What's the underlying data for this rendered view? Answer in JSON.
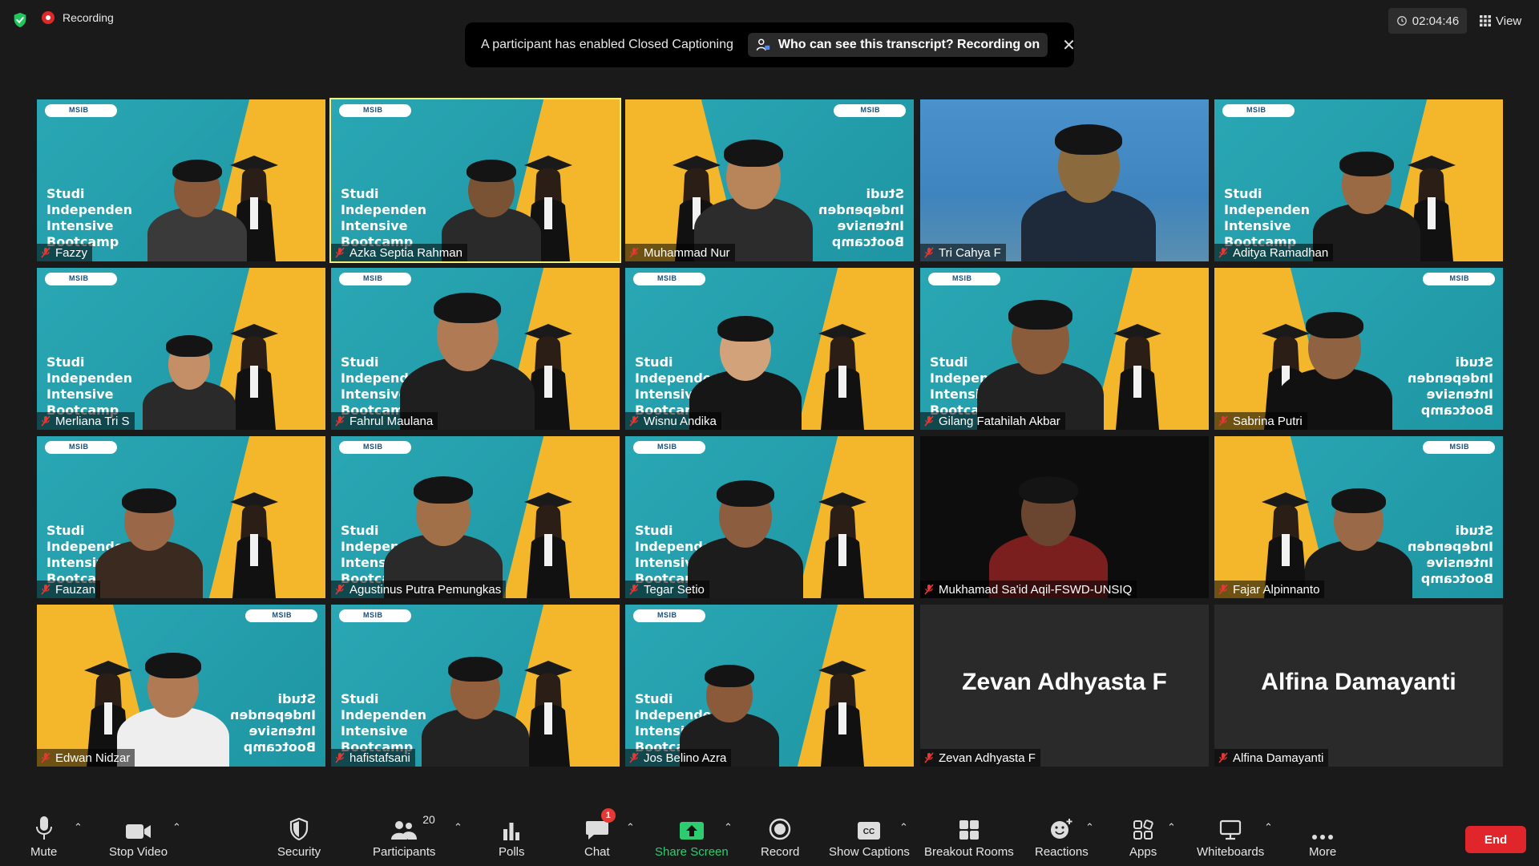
{
  "top": {
    "recording_label": "Recording",
    "toast_message": "A participant has enabled Closed Captioning",
    "toast_action": "Who can see this transcript? Recording on",
    "timer": "02:04:46",
    "view_label": "View"
  },
  "slide": {
    "logo": "MSIB",
    "line1": "Studi",
    "line2": "Independen",
    "line3": "Intensive",
    "line4": "Bootcamp"
  },
  "participants": [
    "Fazzy",
    "Azka Septia Rahman",
    "Muhammad Nur",
    "Tri Cahya F",
    "Aditya Ramadhan",
    "Merliana Tri S",
    "Fahrul Maulana",
    "Wisnu Andika",
    "Gilang Fatahilah Akbar",
    "Sabrina Putri",
    "Fauzan",
    "Agustinus Putra Pemungkas",
    "Tegar Setio",
    "Mukhamad Sa'id Aqil-FSWD-UNSIQ",
    "Fajar Alpinnanto",
    "Edwan Nidzar",
    "hafistafsani",
    "Jos Belino Azra",
    "Zevan Adhyasta F",
    "Alfina Damayanti"
  ],
  "toolbar": {
    "mute": "Mute",
    "stop_video": "Stop Video",
    "security": "Security",
    "participants": "Participants",
    "participants_count": "20",
    "polls": "Polls",
    "chat": "Chat",
    "chat_badge": "1",
    "share_screen": "Share Screen",
    "record": "Record",
    "show_captions": "Show Captions",
    "breakout_rooms": "Breakout Rooms",
    "reactions": "Reactions",
    "apps": "Apps",
    "whiteboards": "Whiteboards",
    "more": "More",
    "end": "End"
  },
  "colors": {
    "teal": "#2aa7b4",
    "yellow": "#f4b62a",
    "active_border": "#f1ef7a",
    "end_red": "#e0262a",
    "share_green": "#2ecc71"
  }
}
